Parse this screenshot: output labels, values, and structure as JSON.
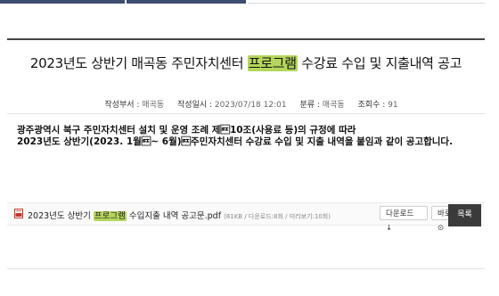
{
  "post": {
    "title_before": "2023년도 상반기 매곡동 주민자치센터 ",
    "title_highlight": "프로그램",
    "title_after": " 수강료 수입 및 지출내역 공고",
    "meta": {
      "author_label": "작성부서 :",
      "author": "매곡동",
      "date_label": "작성일시 :",
      "date": "2023/07/18 12:01",
      "category_label": "분류 :",
      "category": "매곡동",
      "views_label": "조회수 :",
      "views": "91"
    },
    "body_line1": "광주광역시 북구 주민자치센터 설치 및 운영 조례 제\u000f10조(사용료 등)의 규정에 따라",
    "body_line2": "2023년도 상반기(2023. 1월\u000f~ 6월)\u000f주민자치센터 수강료 수입 및 지출 내역을 붙임과 같이 공고합니다."
  },
  "attachment": {
    "name_before": "2023년도 상반기 ",
    "name_highlight": "프로그램",
    "name_after": " 수입지출 내역 공고문.pdf",
    "info": "(81KB / 다운로드:8회 / 미리보기:10회)",
    "download_label": "다운로드 ↓",
    "preview_label": "바로보기 ⊙"
  },
  "list_button": "목록",
  "colors": {
    "highlight": "#b5d65c",
    "tab": "#3d4d6e",
    "list_button": "#3a3a3a"
  }
}
